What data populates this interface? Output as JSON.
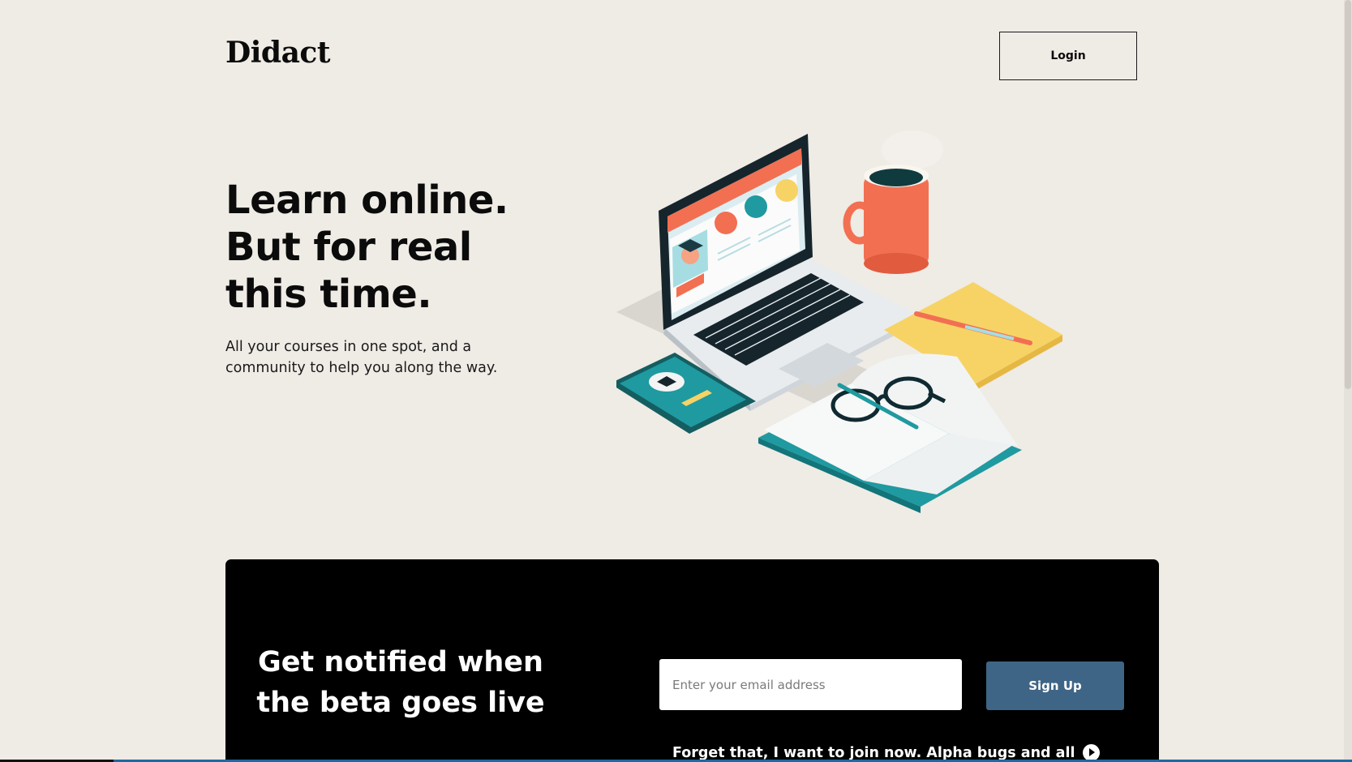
{
  "header": {
    "logo": "Didact",
    "login_label": "Login"
  },
  "hero": {
    "title_lines": [
      "Learn online.",
      "But for real",
      "this time."
    ],
    "subtitle": "All your courses in one spot, and a community to help you along the way."
  },
  "beta": {
    "title_lines": [
      "Get notified when",
      "the beta goes live"
    ],
    "email_placeholder": "Enter your email address",
    "signup_label": "Sign Up",
    "join_link": "Forget that, I want to join now. Alpha bugs and all"
  },
  "colors": {
    "background": "#efebe5",
    "panel": "#000000",
    "signup_button": "#3f6586",
    "accent_orange": "#f26f52",
    "accent_teal": "#1f9aa0",
    "accent_yellow": "#f7d366"
  }
}
